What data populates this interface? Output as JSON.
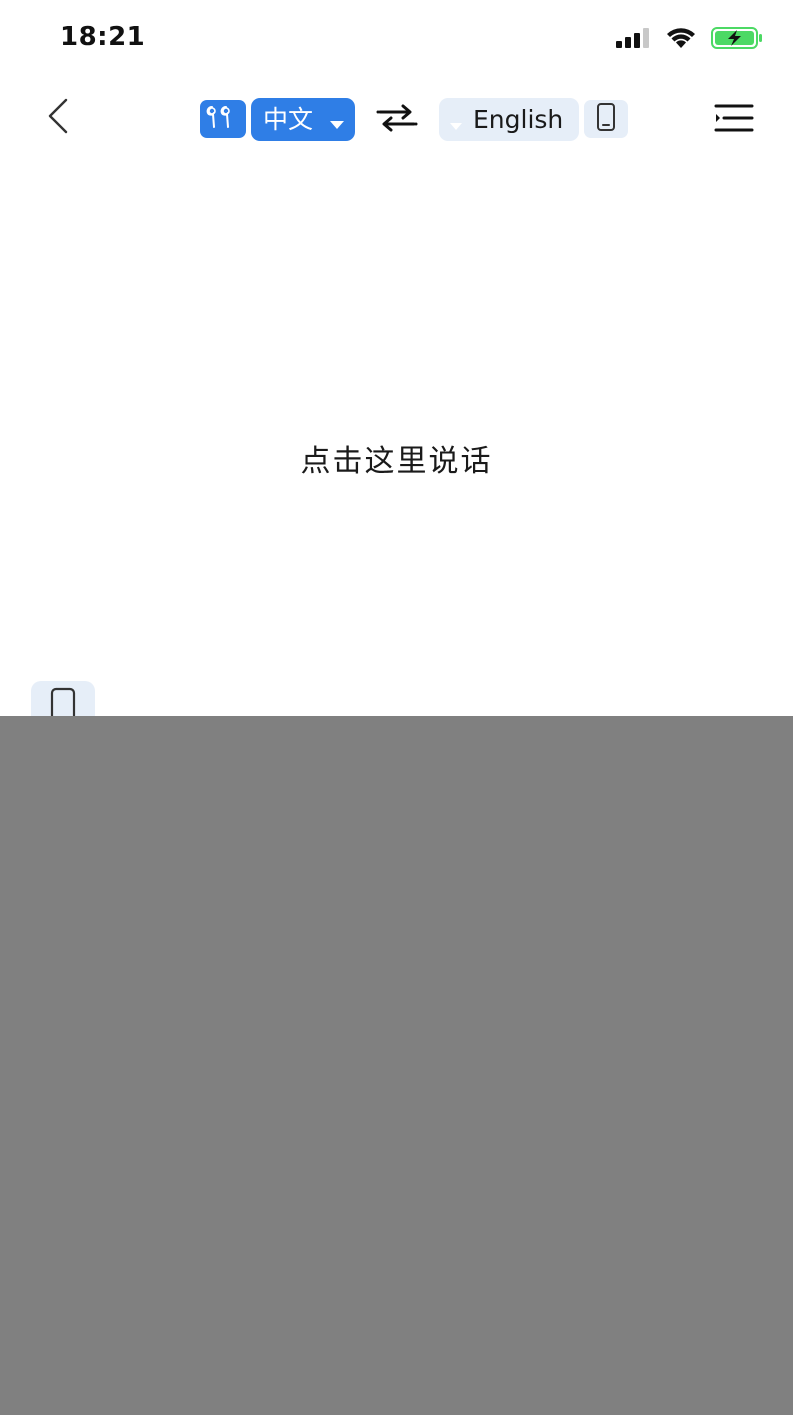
{
  "status_bar": {
    "time": "18:21"
  },
  "nav": {
    "source_language": "中文",
    "target_language": "English"
  },
  "main": {
    "tap_prompt": "点击这里说话"
  },
  "icons": {
    "back": "chevron-left-icon",
    "earbuds": "earbuds-icon",
    "swap": "swap-arrows-icon",
    "phone": "phone-icon",
    "menu": "menu-icon"
  },
  "colors": {
    "accent": "#2f7ee6",
    "chip_bg": "#e6eef8",
    "overlay": "#808080",
    "battery_green": "#4cd964"
  }
}
